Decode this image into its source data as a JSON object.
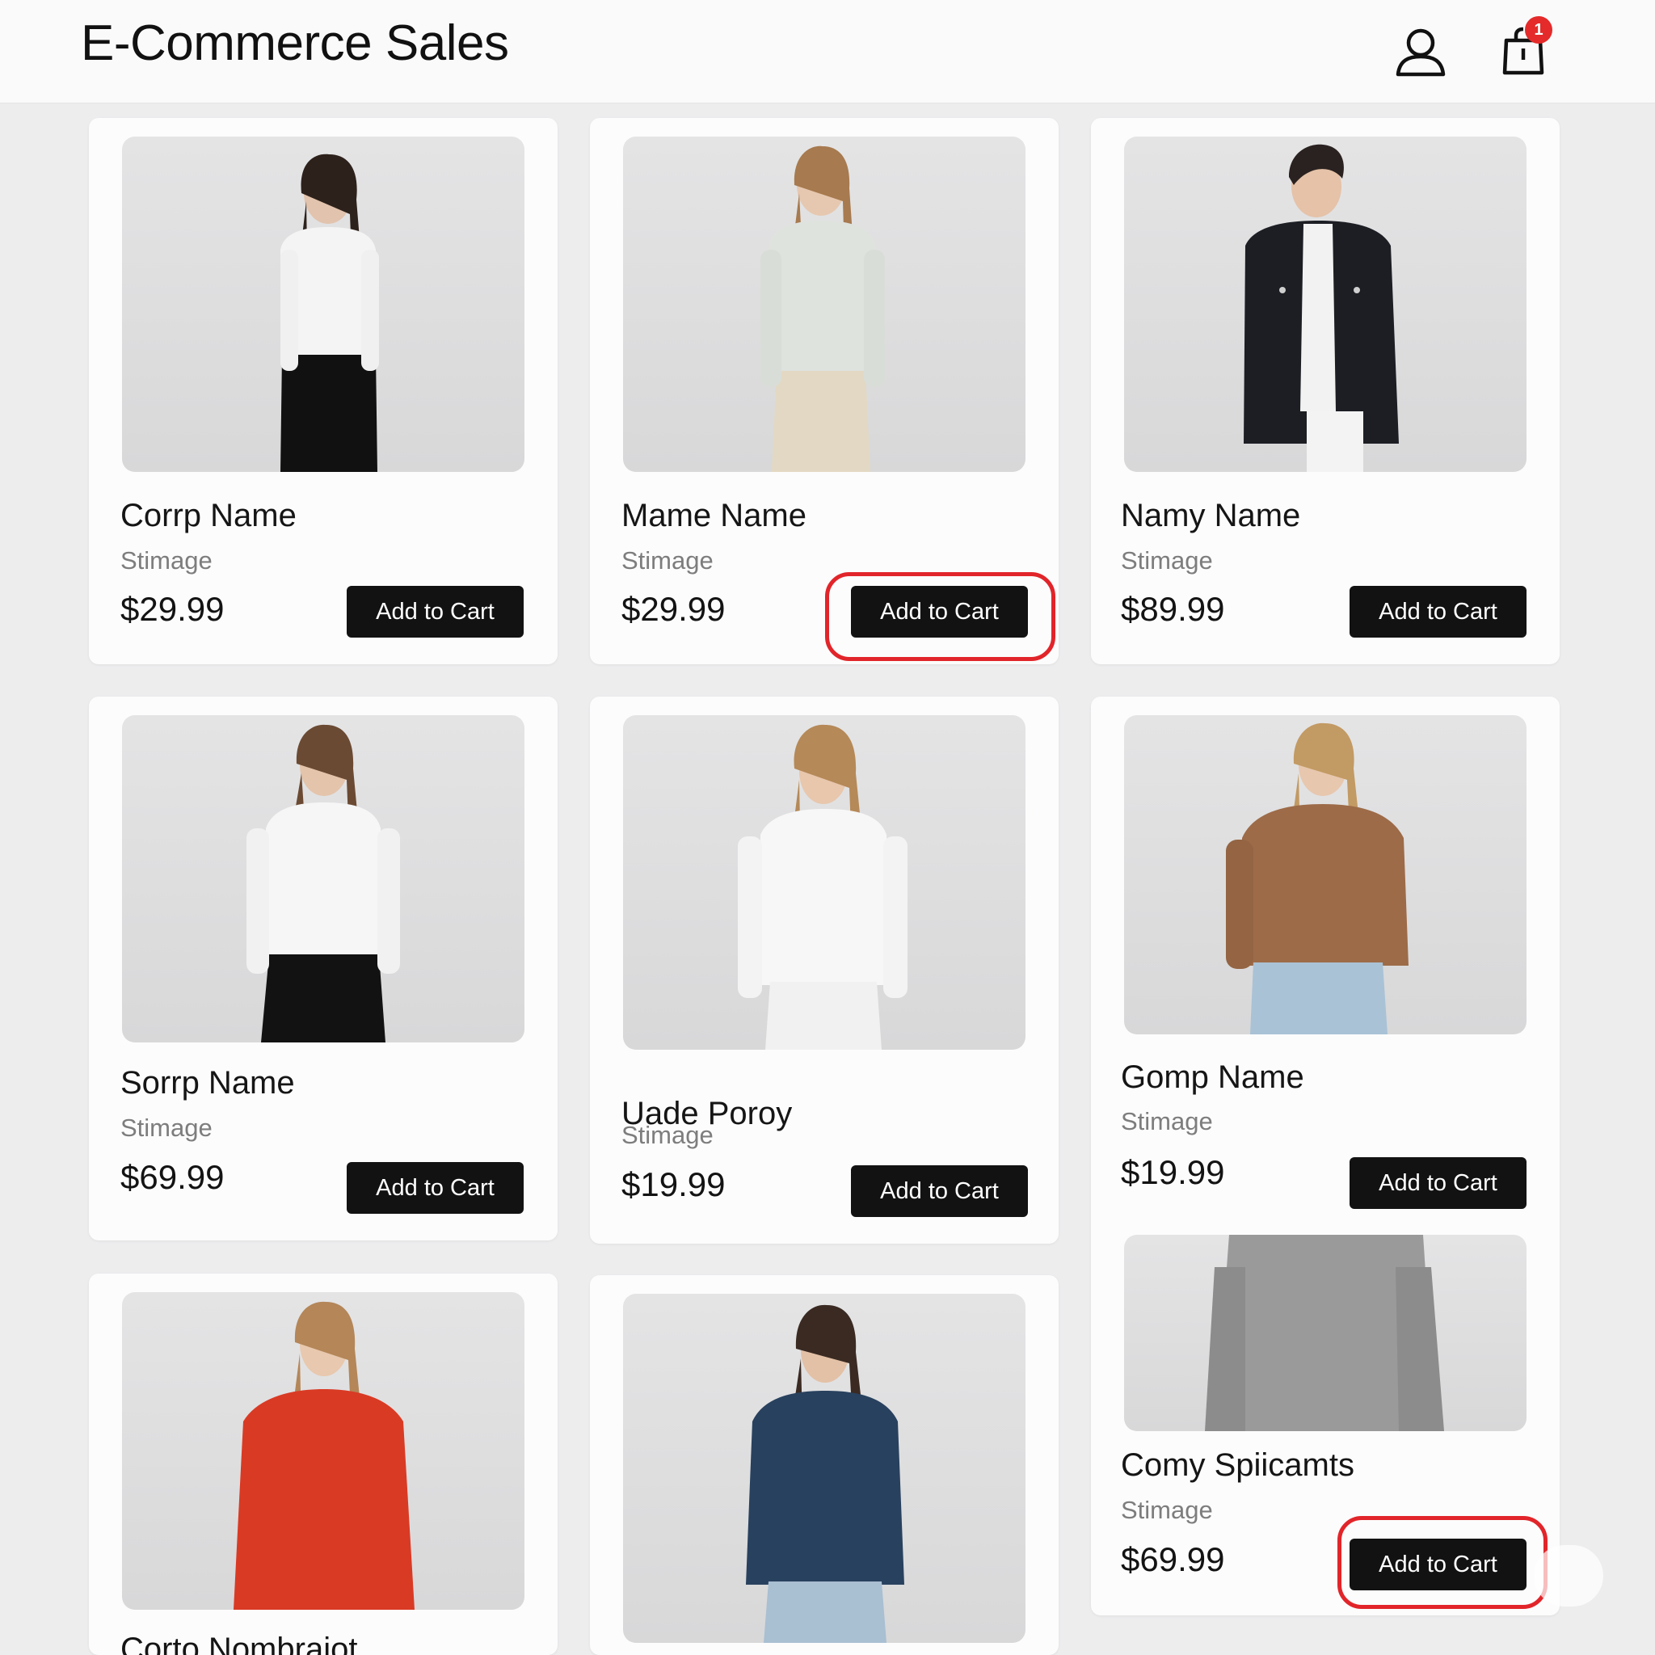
{
  "header": {
    "title": "E-Commerce Sales",
    "cart_badge": "1",
    "icons": [
      "user-icon",
      "shopping-bag-icon"
    ]
  },
  "accent_color": "#e1252a",
  "products": [
    {
      "name": "Corrp Name",
      "subtitle": "Stimage",
      "price": "$29.99",
      "button": "Add to Cart",
      "garment": "white blouse, black trousers"
    },
    {
      "name": "Mame Name",
      "subtitle": "Stimage",
      "price": "$29.99",
      "button": "Add to Cart",
      "garment": "light grey shirt, beige trousers"
    },
    {
      "name": "Namy Name",
      "subtitle": "Stimage",
      "price": "$89.99",
      "button": "Add to Cart",
      "garment": "dark denim jacket"
    },
    {
      "name": "Sorrp Name",
      "subtitle": "Stimage",
      "price": "$69.99",
      "button": "Add to Cart",
      "garment": "white top, black skirt"
    },
    {
      "name": "Uade Poroy",
      "subtitle": "Stimage",
      "price": "$19.99",
      "button": "Add to Cart",
      "garment": "white shirt, white jeans"
    },
    {
      "name": "Gomp Name",
      "subtitle": "Stimage",
      "price": "$19.99",
      "button": "Add to Cart",
      "garment": "brown sweater, blue jeans"
    },
    {
      "name": "Comy Spiicamts",
      "subtitle": "Stimage",
      "price": "$69.99",
      "button": "Add to Cart",
      "garment": "grey knit top"
    },
    {
      "name": "Corto Nombraiot",
      "subtitle": "",
      "price": "",
      "button": "",
      "garment": "red sweater"
    },
    {
      "name": "",
      "subtitle": "",
      "price": "",
      "button": "",
      "garment": "blue denim jacket"
    }
  ],
  "highlighted_buttons": [
    "Mame Name",
    "Comy Spiicamts"
  ]
}
